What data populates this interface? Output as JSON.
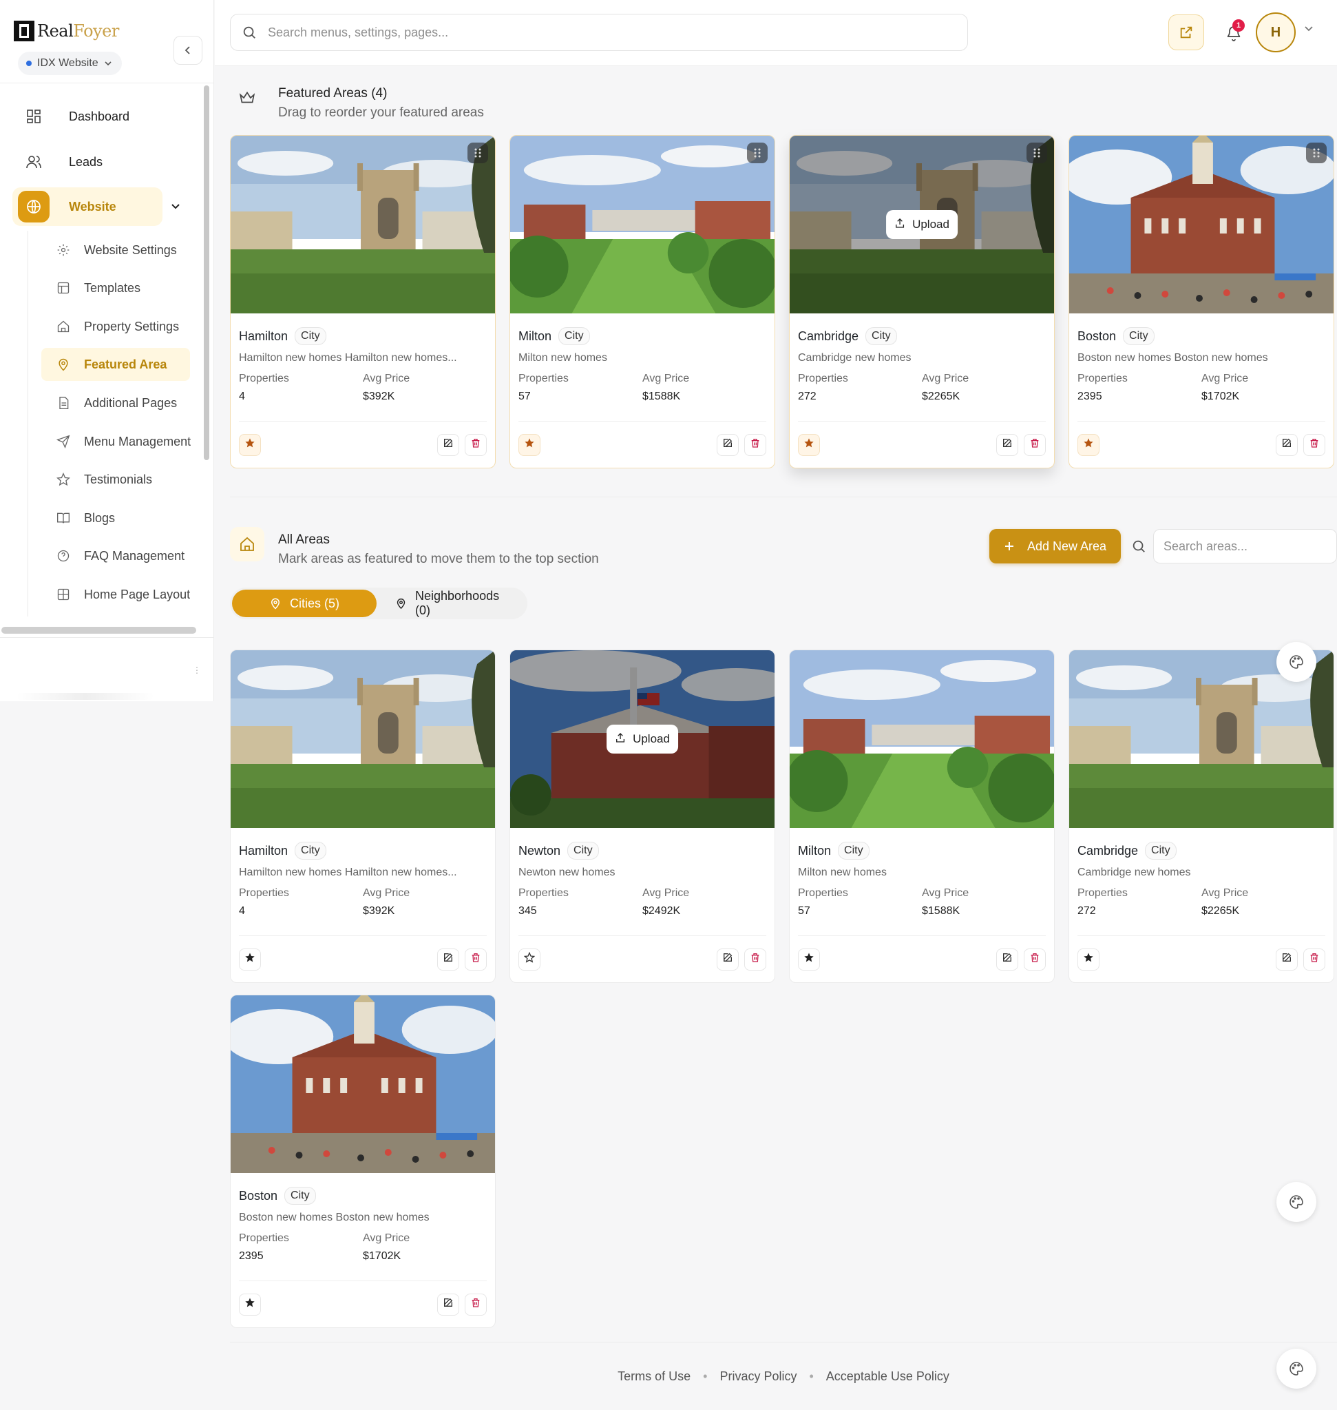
{
  "brand": {
    "name_a": "Real",
    "name_b": "Foyer",
    "site_selector": "IDX Website"
  },
  "search": {
    "placeholder": "Search menus, settings, pages..."
  },
  "header": {
    "notifications_count": "1",
    "avatar_initial": "H"
  },
  "sidebar": {
    "items": [
      {
        "label": "Dashboard",
        "icon": "dashboard-icon"
      },
      {
        "label": "Leads",
        "icon": "users-icon"
      },
      {
        "label": "Website",
        "icon": "globe-icon"
      }
    ],
    "sub_items": [
      {
        "label": "Website Settings",
        "icon": "gear-icon"
      },
      {
        "label": "Templates",
        "icon": "template-icon"
      },
      {
        "label": "Property Settings",
        "icon": "home-icon"
      },
      {
        "label": "Featured Area",
        "icon": "map-pin-icon"
      },
      {
        "label": "Additional Pages",
        "icon": "file-icon"
      },
      {
        "label": "Menu Management",
        "icon": "send-icon"
      },
      {
        "label": "Testimonials",
        "icon": "star-icon"
      },
      {
        "label": "Blogs",
        "icon": "book-icon"
      },
      {
        "label": "FAQ Management",
        "icon": "help-icon"
      },
      {
        "label": "Home Page Layout",
        "icon": "layout-icon"
      }
    ]
  },
  "featured": {
    "title": "Featured Areas (4)",
    "subtitle": "Drag to reorder your featured areas",
    "cards": [
      {
        "name": "Hamilton",
        "type": "City",
        "desc": "Hamilton new homes Hamilton new homes...",
        "properties_label": "Properties",
        "properties": "4",
        "price_label": "Avg Price",
        "price": "$392K",
        "scene": "cambridge"
      },
      {
        "name": "Milton",
        "type": "City",
        "desc": "Milton new homes",
        "properties_label": "Properties",
        "properties": "57",
        "price_label": "Avg Price",
        "price": "$1588K",
        "scene": "campus"
      },
      {
        "name": "Cambridge",
        "type": "City",
        "desc": "Cambridge new homes",
        "properties_label": "Properties",
        "properties": "272",
        "price_label": "Avg Price",
        "price": "$2265K",
        "scene": "cambridge",
        "upload": "Upload"
      },
      {
        "name": "Boston",
        "type": "City",
        "desc": "Boston new homes Boston new homes",
        "properties_label": "Properties",
        "properties": "2395",
        "price_label": "Avg Price",
        "price": "$1702K",
        "scene": "boston"
      }
    ]
  },
  "all_areas": {
    "title": "All Areas",
    "subtitle": "Mark areas as featured to move them to the top section",
    "add_button": "Add New Area",
    "search_placeholder": "Search areas...",
    "tabs": [
      "Cities (5)",
      "Neighborhoods (0)"
    ],
    "cards": [
      {
        "name": "Hamilton",
        "type": "City",
        "desc": "Hamilton new homes Hamilton new homes...",
        "properties_label": "Properties",
        "properties": "4",
        "price_label": "Avg Price",
        "price": "$392K",
        "scene": "cambridge"
      },
      {
        "name": "Newton",
        "type": "City",
        "desc": "Newton new homes",
        "properties_label": "Properties",
        "properties": "345",
        "price_label": "Avg Price",
        "price": "$2492K",
        "scene": "newton",
        "upload": "Upload"
      },
      {
        "name": "Milton",
        "type": "City",
        "desc": "Milton new homes",
        "properties_label": "Properties",
        "properties": "57",
        "price_label": "Avg Price",
        "price": "$1588K",
        "scene": "campus"
      },
      {
        "name": "Cambridge",
        "type": "City",
        "desc": "Cambridge new homes",
        "properties_label": "Properties",
        "properties": "272",
        "price_label": "Avg Price",
        "price": "$2265K",
        "scene": "cambridge"
      },
      {
        "name": "Boston",
        "type": "City",
        "desc": "Boston new homes Boston new homes",
        "properties_label": "Properties",
        "properties": "2395",
        "price_label": "Avg Price",
        "price": "$1702K",
        "scene": "boston"
      }
    ]
  },
  "footer": {
    "links": [
      "Terms of Use",
      "Privacy Policy",
      "Acceptable Use Policy"
    ],
    "separator": "•"
  },
  "colors": {
    "accent": "#dd9b12",
    "accent_dark": "#b8860b",
    "danger": "#e11d48"
  }
}
